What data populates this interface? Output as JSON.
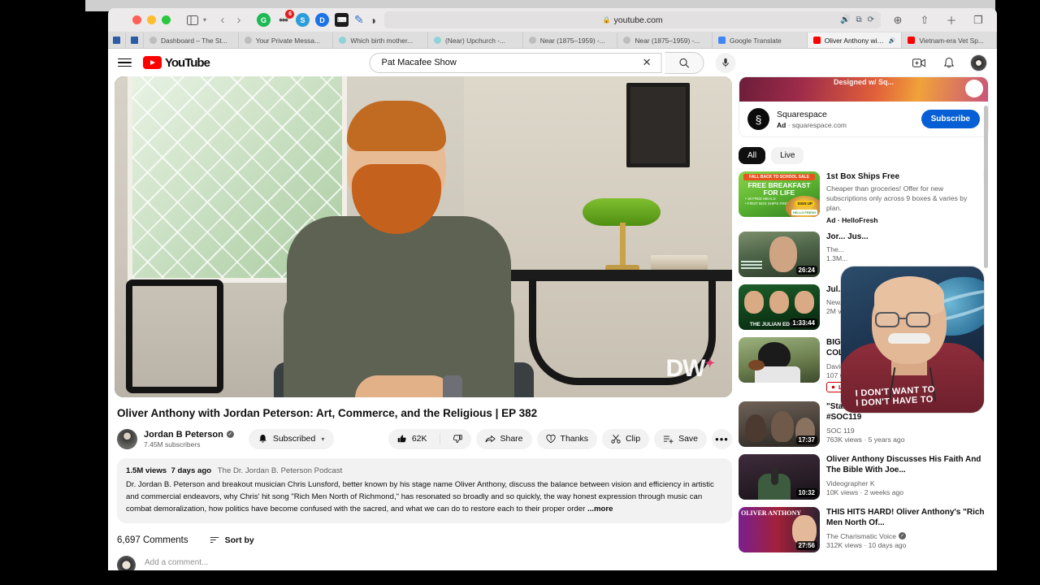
{
  "browser": {
    "url": "youtube.com",
    "lock_icon": "lock-icon",
    "notification_badge": "6",
    "tabs": [
      {
        "label": "Dashboard – The St...",
        "fav": "fav-grey",
        "active": false
      },
      {
        "label": "Your Private Messa...",
        "fav": "fav-grey",
        "active": false
      },
      {
        "label": "Which birth mother...",
        "fav": "fav-globe",
        "active": false
      },
      {
        "label": "(Near) Upchurch -...",
        "fav": "fav-globe",
        "active": false
      },
      {
        "label": "Near (1875–1959) -...",
        "fav": "fav-grey",
        "active": false
      },
      {
        "label": "Near (1875–1959) -...",
        "fav": "fav-grey",
        "active": false
      },
      {
        "label": "Google Translate",
        "fav": "fav-blue",
        "active": false
      },
      {
        "label": "Oliver Anthony with...",
        "fav": "fav-yt",
        "active": true,
        "audio": true
      },
      {
        "label": "Vietnam-era Vet Sp...",
        "fav": "fav-yt",
        "active": false
      }
    ]
  },
  "youtube": {
    "logo_text": "YouTube",
    "search": {
      "value": "Pat Macafee Show",
      "placeholder": "Search",
      "clear_icon": "close-icon",
      "search_icon": "search-icon",
      "mic_icon": "microphone-icon"
    },
    "header_icons": {
      "create": "create-video-icon",
      "notifications": "bell-icon",
      "account": "avatar"
    }
  },
  "video": {
    "title": "Oliver Anthony with Jordan Peterson: Art, Commerce, and the Religious | EP 382",
    "watermark": "DW",
    "channel": {
      "name": "Jordan B Peterson",
      "subscribers": "7.45M subscribers",
      "verified": true,
      "subscribe_label": "Subscribed"
    },
    "actions": {
      "like_count": "62K",
      "share": "Share",
      "thanks": "Thanks",
      "clip": "Clip",
      "save": "Save",
      "more": "•••"
    },
    "description": {
      "views": "1.5M views",
      "age": "7 days ago",
      "podcast": "The Dr. Jordan B. Peterson Podcast",
      "body": "Dr. Jordan B. Peterson and breakout musician Chris Lunsford, better known by his stage name Oliver Anthony, discuss the balance between vision and efficiency in artistic and commercial endeavors, why Chris' hit song \"Rich Men North of Richmond,\" has resonated so broadly and so quickly, the way honest expression through music can combat demoralization, how politics have become confused with the sacred, and what we can do to restore each to their proper order",
      "more_label": "...more"
    }
  },
  "comments": {
    "count_label": "6,697 Comments",
    "sort_label": "Sort by",
    "add_placeholder": "Add a comment..."
  },
  "sidebar": {
    "ad_card": {
      "banner_caption": "Designed w/ Sq...",
      "brand": "Squarespace",
      "ad_label": "Ad",
      "domain": "squarespace.com",
      "subscribe_label": "Subscribe"
    },
    "chips": [
      {
        "label": "All",
        "selected": true
      },
      {
        "label": "Live",
        "selected": false
      }
    ],
    "items": [
      {
        "kind": "ad",
        "title": "1st Box Ships Free",
        "body": "Cheaper than groceries! Offer for new subscriptions only across 9 boxes & varies by plan.",
        "ad_line": "Ad · HelloFresh",
        "thumb_class": "ad-thumb",
        "thumb_text": {
          "t1": "FALL BACK TO SCHOOL SALE",
          "t2": "FREE BREAKFAST FOR LIFE",
          "t3": "• 18 FREE MEALS\n• FIRST BOX SHIPS FREE",
          "sign": "SIGN UP",
          "hf": "HELLO FRESH"
        },
        "kebab": true
      },
      {
        "kind": "video",
        "title": "Jor... Jus...",
        "channel": "The...",
        "stats": "1.3M...",
        "duration": "26:24",
        "thumb_class": "thumb-jp",
        "occluded": true
      },
      {
        "kind": "video",
        "title": "Jul... Rel...",
        "channel": "New...",
        "stats": "2M v...",
        "duration": "1:33:44",
        "thumb_class": "thumb-ed",
        "occluded": true
      },
      {
        "kind": "video",
        "title": "BIG NAME RECRUITS VISITING COLORADO w/ RobDaMan |...",
        "channel": "David Talks Buffs",
        "stats": "107 watching",
        "live": true,
        "live_label": "LIVE",
        "duration": "",
        "thumb_class": "thumb-fb"
      },
      {
        "kind": "video",
        "title": "\"Statistics on Cop on Black Crime\" - #SOC119",
        "channel": "SOC 119",
        "stats": "763K views  ·  5 years ago",
        "duration": "17:37",
        "thumb_class": "thumb-soc"
      },
      {
        "kind": "video",
        "title": "Oliver Anthony Discusses His Faith And The Bible With Joe...",
        "channel": "Videographer K",
        "stats": "10K views  ·  2 weeks ago",
        "duration": "10:32",
        "thumb_class": "thumb-oa"
      },
      {
        "kind": "video",
        "title": "THIS HITS HARD! Oliver Anthony's \"Rich Men North Of...",
        "channel": "The Charismatic Voice",
        "channel_verified": true,
        "stats": "312K views  ·  10 days ago",
        "duration": "27:56",
        "thumb_class": "thumb-cv",
        "thumb_text": {
          "ttl": "OLIVER ANTHONY"
        }
      }
    ]
  },
  "webcam": {
    "shirt_text": "I DON'T WANT TO\nI DON'T HAVE TO"
  }
}
